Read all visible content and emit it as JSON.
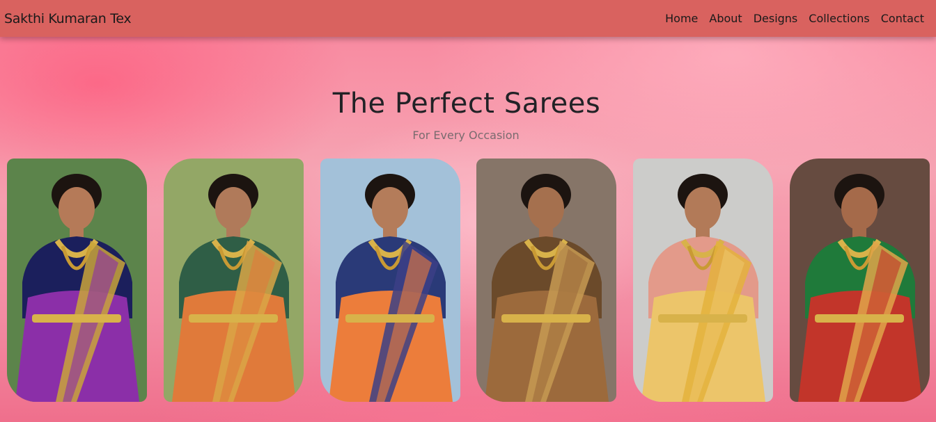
{
  "navbar": {
    "brand": "Sakthi Kumaran Tex",
    "links": [
      "Home",
      "About",
      "Designs",
      "Collections",
      "Contact"
    ]
  },
  "hero": {
    "title": "The Perfect Sarees",
    "subtitle": "For Every Occasion"
  },
  "gallery": {
    "cards": [
      {
        "background": "#4f7a3c",
        "saree": "#8b2fa8",
        "border": "#c9a43a",
        "blouse": "#1b1f5c",
        "skin": "#b57a58"
      },
      {
        "background": "#8aa05a",
        "saree": "#e07a3a",
        "border": "#d9a646",
        "blouse": "#2f5e46",
        "skin": "#b07a5a"
      },
      {
        "background": "#9cbcd6",
        "saree": "#ec7d3b",
        "border": "#3c3f86",
        "blouse": "#2a3a78",
        "skin": "#b47c5a"
      },
      {
        "background": "#7c6a5c",
        "saree": "#9c6a3c",
        "border": "#c79a52",
        "blouse": "#6b4a2a",
        "skin": "#a5704e"
      },
      {
        "background": "#c8c8c6",
        "saree": "#ecc56a",
        "border": "#e4b13c",
        "blouse": "#e39a8a",
        "skin": "#b27a58"
      },
      {
        "background": "#5a3c30",
        "saree": "#c2352a",
        "border": "#e0a44a",
        "blouse": "#1f7a3a",
        "skin": "#a56a4a"
      }
    ]
  }
}
